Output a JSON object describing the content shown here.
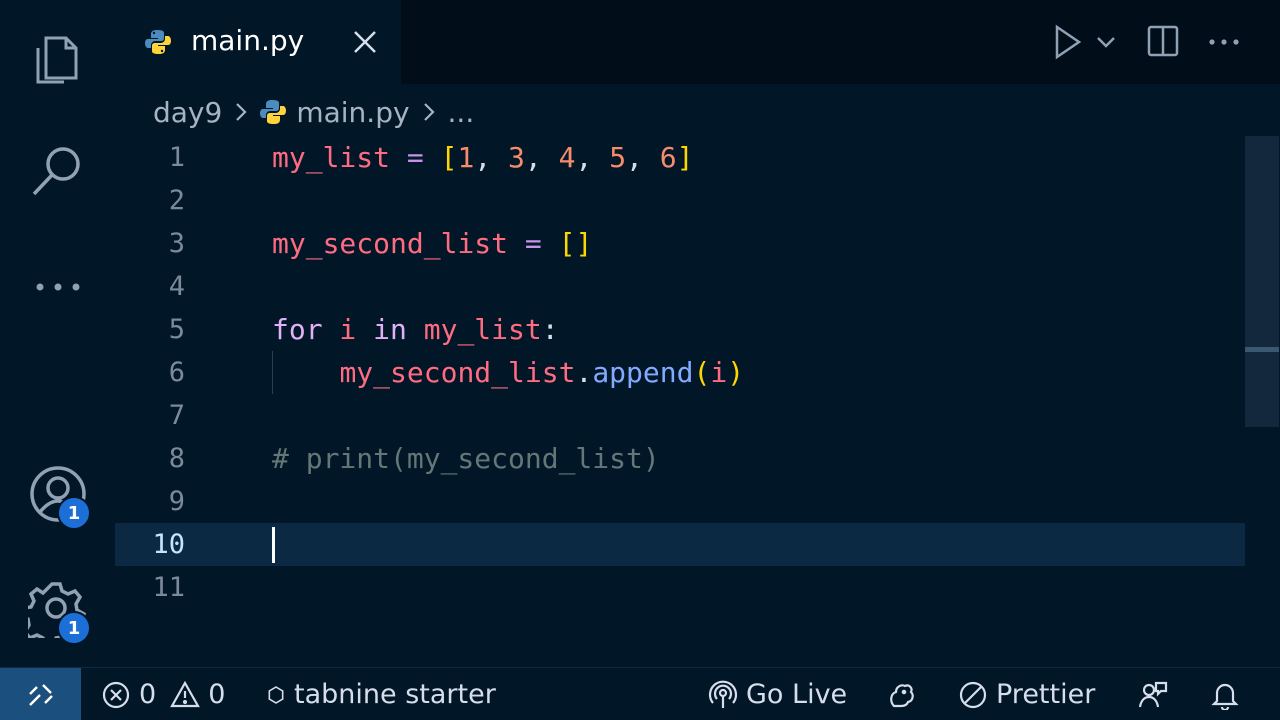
{
  "tabs": [
    {
      "label": "main.py",
      "icon": "python-file-icon",
      "active": true
    }
  ],
  "breadcrumb": {
    "folder": "day9",
    "file": "main.py",
    "symbol": "..."
  },
  "editor": {
    "current_line": 10,
    "lines": [
      {
        "number": "1"
      },
      {
        "number": "2"
      },
      {
        "number": "3"
      },
      {
        "number": "4"
      },
      {
        "number": "5"
      },
      {
        "number": "6"
      },
      {
        "number": "7"
      },
      {
        "number": "8"
      },
      {
        "number": "9"
      },
      {
        "number": "10"
      },
      {
        "number": "11"
      }
    ],
    "tokens": {
      "l1_var": "my_list",
      "l1_eq": " = ",
      "l1_open": "[",
      "l1_n1": "1",
      "l1_n2": "3",
      "l1_n3": "4",
      "l1_n4": "5",
      "l1_n5": "6",
      "l1_comma": ", ",
      "l1_close": "]",
      "l3_var": "my_second_list",
      "l3_eq": " = ",
      "l3_brackets": "[]",
      "l5_for": "for",
      "l5_i": " i ",
      "l5_in": "in",
      "l5_list": " my_list",
      "l5_colon": ":",
      "l6_indent": "    ",
      "l6_var": "my_second_list",
      "l6_dot": ".",
      "l6_fn": "append",
      "l6_open": "(",
      "l6_arg": "i",
      "l6_close": ")",
      "l8_comment": "# print(my_second_list)"
    }
  },
  "activity_bar": {
    "accounts_badge": "1",
    "settings_badge": "1"
  },
  "status_bar": {
    "errors": "0",
    "warnings": "0",
    "tabnine": "tabnine starter",
    "go_live": "Go Live",
    "prettier": "Prettier"
  },
  "colors": {
    "background": "#011627",
    "variable": "#ff6b81",
    "keyword": "#e2b1f5",
    "bracket": "#ffd700",
    "number": "#f78c6c",
    "function": "#82aaff",
    "comment": "#637777",
    "badge": "#1b6fd6"
  }
}
